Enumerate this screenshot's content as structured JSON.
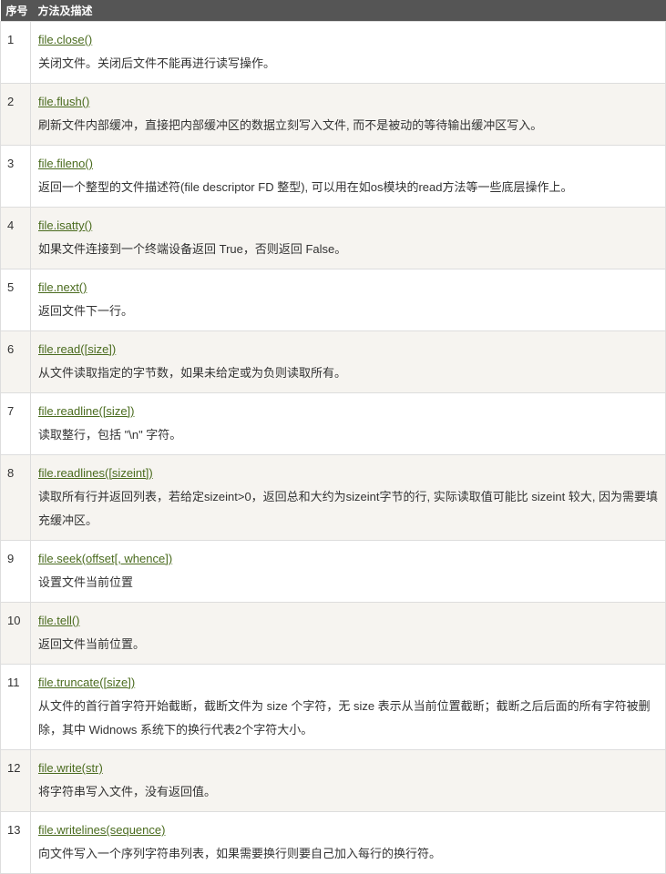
{
  "header": {
    "col_num": "序号",
    "col_method": "方法及描述"
  },
  "rows": [
    {
      "num": "1",
      "method": "file.close()",
      "desc": "关闭文件。关闭后文件不能再进行读写操作。"
    },
    {
      "num": "2",
      "method": "file.flush()",
      "desc": "刷新文件内部缓冲，直接把内部缓冲区的数据立刻写入文件, 而不是被动的等待输出缓冲区写入。"
    },
    {
      "num": "3",
      "method": "file.fileno()",
      "desc": "返回一个整型的文件描述符(file descriptor FD 整型), 可以用在如os模块的read方法等一些底层操作上。"
    },
    {
      "num": "4",
      "method": "file.isatty()",
      "desc": "如果文件连接到一个终端设备返回 True，否则返回 False。"
    },
    {
      "num": "5",
      "method": "file.next()",
      "desc": "返回文件下一行。"
    },
    {
      "num": "6",
      "method": "file.read([size])",
      "desc": "从文件读取指定的字节数，如果未给定或为负则读取所有。"
    },
    {
      "num": "7",
      "method": "file.readline([size])",
      "desc": "读取整行，包括 \"\\n\" 字符。"
    },
    {
      "num": "8",
      "method": "file.readlines([sizeint])",
      "desc": "读取所有行并返回列表，若给定sizeint>0，返回总和大约为sizeint字节的行, 实际读取值可能比 sizeint 较大, 因为需要填充缓冲区。"
    },
    {
      "num": "9",
      "method": "file.seek(offset[, whence])",
      "desc": "设置文件当前位置"
    },
    {
      "num": "10",
      "method": "file.tell()",
      "desc": "返回文件当前位置。"
    },
    {
      "num": "11",
      "method": "file.truncate([size])",
      "desc": "从文件的首行首字符开始截断，截断文件为 size 个字符，无 size 表示从当前位置截断；截断之后后面的所有字符被删除，其中 Widnows 系统下的换行代表2个字符大小。"
    },
    {
      "num": "12",
      "method": "file.write(str)",
      "desc": "将字符串写入文件，没有返回值。"
    },
    {
      "num": "13",
      "method": "file.writelines(sequence)",
      "desc": "向文件写入一个序列字符串列表，如果需要换行则要自己加入每行的换行符。"
    }
  ]
}
